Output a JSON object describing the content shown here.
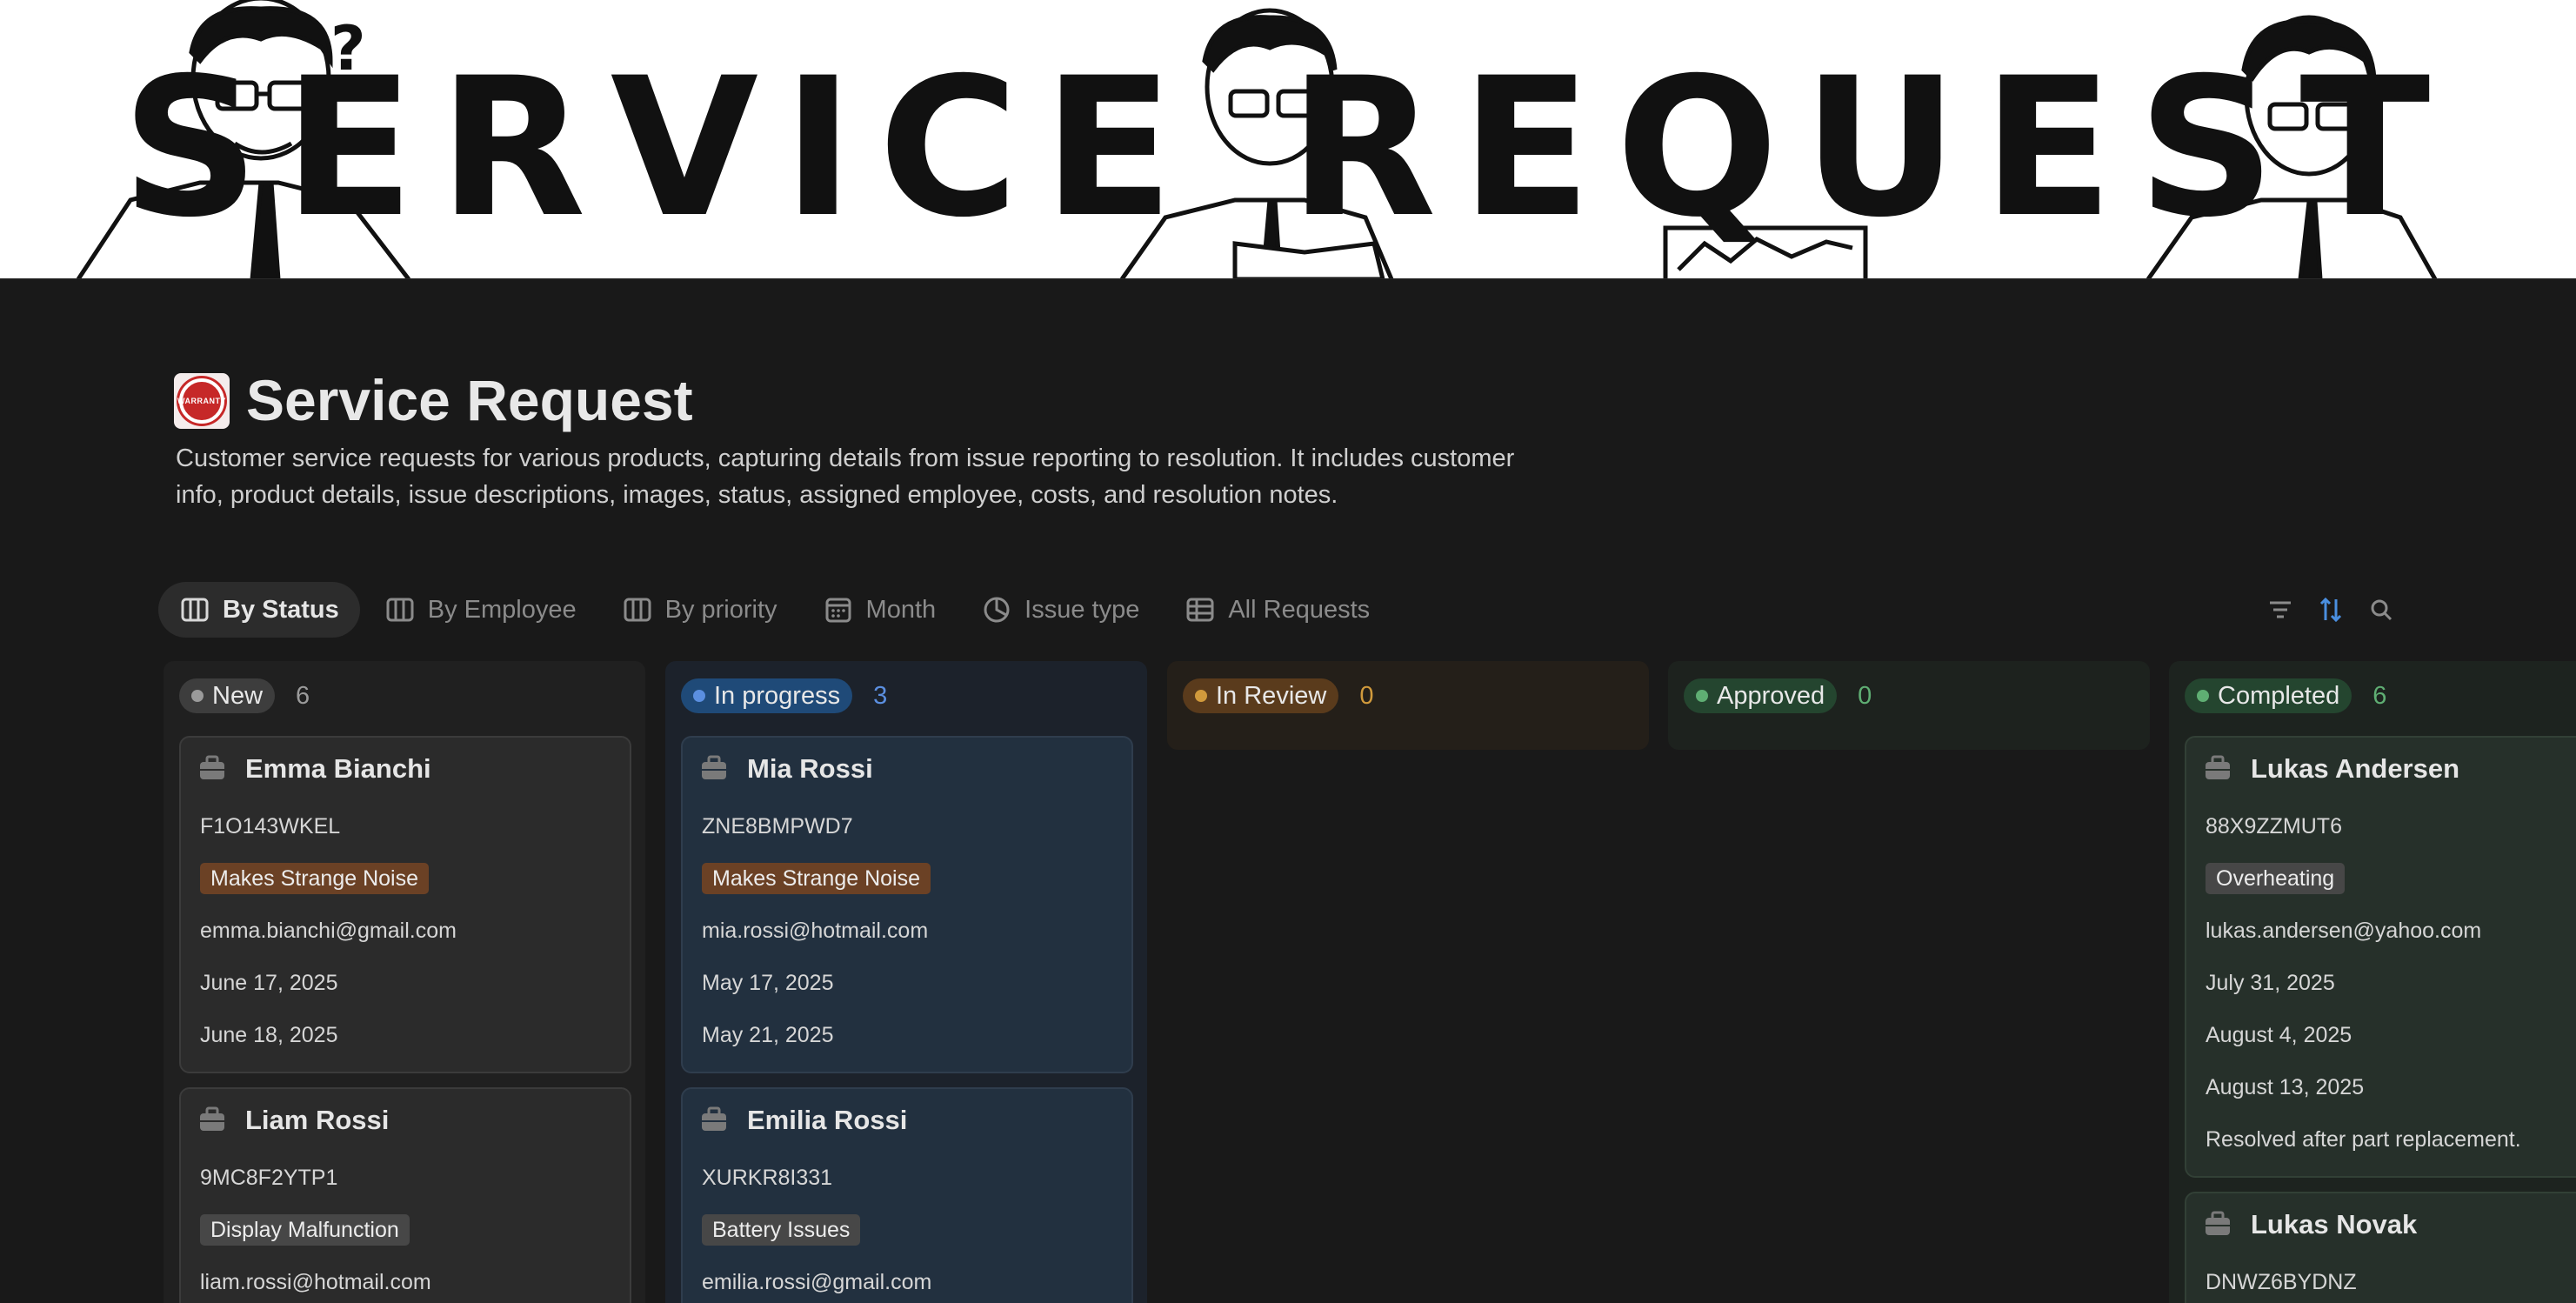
{
  "banner": {
    "title": "SERVICE REQUEST"
  },
  "page": {
    "title": "Service Request",
    "description": "Customer service requests for various products, capturing details from issue reporting to resolution. It includes customer info, product details, issue descriptions, images, status, assigned employee, costs, and resolution notes."
  },
  "tabs": [
    {
      "label": "By Status",
      "icon": "board-icon",
      "active": true
    },
    {
      "label": "By Employee",
      "icon": "board-icon"
    },
    {
      "label": "By priority",
      "icon": "board-icon"
    },
    {
      "label": "Month",
      "icon": "calendar-icon"
    },
    {
      "label": "Issue type",
      "icon": "chart-icon"
    },
    {
      "label": "All Requests",
      "icon": "table-icon"
    }
  ],
  "toolbar": {
    "icons": [
      "filter-icon",
      "sort-icon",
      "search-icon"
    ],
    "accent": "#4a8fe0"
  },
  "columns": [
    {
      "name": "New",
      "count": "6",
      "dot": "#9b9b9b",
      "badge_bg": "#3d3d3d",
      "count_color": "#9b9b9b",
      "cards": [
        {
          "name": "Emma Bianchi",
          "id": "F1O143WKEL",
          "issue": "Makes Strange Noise",
          "issue_color": "brown",
          "email": "emma.bianchi@gmail.com",
          "date1": "June 17, 2025",
          "date2": "June 18, 2025"
        },
        {
          "name": "Liam Rossi",
          "id": "9MC8F2YTP1",
          "issue": "Display Malfunction",
          "issue_color": "gray",
          "email": "liam.rossi@hotmail.com"
        }
      ]
    },
    {
      "name": "In progress",
      "count": "3",
      "dot": "#5b8fe0",
      "badge_bg": "#1f4a78",
      "count_color": "#5b8fe0",
      "cards": [
        {
          "name": "Mia Rossi",
          "id": "ZNE8BMPWD7",
          "issue": "Makes Strange Noise",
          "issue_color": "brown",
          "email": "mia.rossi@hotmail.com",
          "date1": "May 17, 2025",
          "date2": "May 21, 2025"
        },
        {
          "name": "Emilia Rossi",
          "id": "XURKR8I331",
          "issue": "Battery Issues",
          "issue_color": "gray",
          "email": "emilia.rossi@gmail.com"
        }
      ]
    },
    {
      "name": "In Review",
      "count": "0",
      "dot": "#d19a3c",
      "badge_bg": "#5a3b1c",
      "count_color": "#d19a3c",
      "cards": []
    },
    {
      "name": "Approved",
      "count": "0",
      "dot": "#5fae73",
      "badge_bg": "#24452f",
      "count_color": "#5fae73",
      "cards": []
    },
    {
      "name": "Completed",
      "count": "6",
      "dot": "#5fae73",
      "badge_bg": "#24452f",
      "count_color": "#5fae73",
      "cards": [
        {
          "name": "Lukas Andersen",
          "id": "88X9ZZMUT6",
          "issue": "Overheating",
          "issue_color": "gray",
          "email": "lukas.andersen@yahoo.com",
          "date1": "July 31, 2025",
          "date2": "August 4, 2025",
          "date3": "August 13, 2025",
          "note": "Resolved after part replacement."
        },
        {
          "name": "Lukas Novak",
          "id": "DNWZ6BYDNZ"
        }
      ]
    }
  ]
}
